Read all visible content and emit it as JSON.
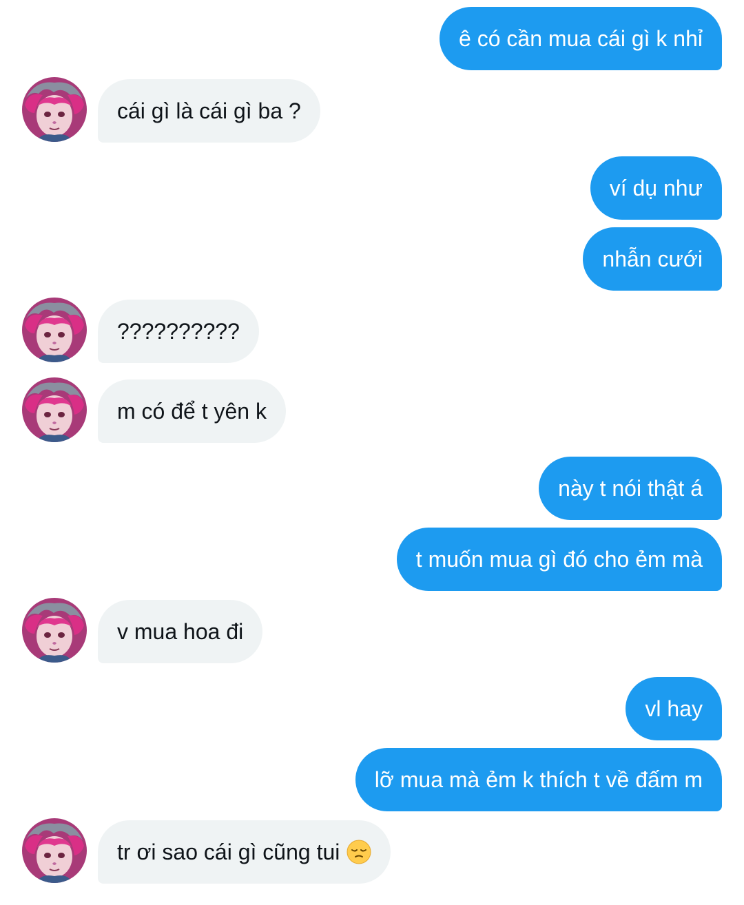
{
  "conversation": {
    "messages": [
      {
        "sender": "me",
        "text": "ê có cần mua cái gì k nhỉ"
      },
      {
        "sender": "them",
        "text": "cái gì là cái gì ba ?"
      },
      {
        "sender": "me",
        "text": "ví dụ như"
      },
      {
        "sender": "me",
        "text": "nhẫn cưới"
      },
      {
        "sender": "them",
        "text": "??????????"
      },
      {
        "sender": "them",
        "text": "m có để t yên k"
      },
      {
        "sender": "me",
        "text": "này t nói thật á"
      },
      {
        "sender": "me",
        "text": "t muốn mua gì đó cho ẻm mà"
      },
      {
        "sender": "them",
        "text": "v mua hoa đi"
      },
      {
        "sender": "me",
        "text": "vl hay"
      },
      {
        "sender": "me",
        "text": "lỡ mua mà ẻm k thích t về đấm m"
      },
      {
        "sender": "them",
        "text": "tr ơi sao cái gì cũng tui",
        "emoji": "pensive-face"
      }
    ]
  },
  "colors": {
    "sent_bubble": "#1d9bf0",
    "received_bubble": "#eff3f4",
    "sent_text": "#ffffff",
    "received_text": "#0f1419"
  }
}
